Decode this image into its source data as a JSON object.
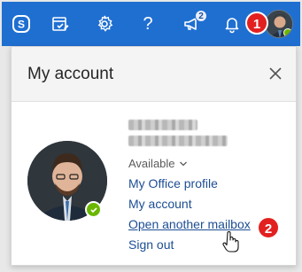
{
  "topbar": {
    "notifications_count": "2",
    "icons": [
      "skype-icon",
      "my-day-icon",
      "gear-icon",
      "help-icon",
      "megaphone-icon",
      "bell-icon"
    ],
    "help_glyph": "?"
  },
  "steps": {
    "step1": "1",
    "step2": "2"
  },
  "panel": {
    "title": "My account",
    "status": "Available",
    "links": [
      {
        "label": "My Office profile"
      },
      {
        "label": "My account"
      },
      {
        "label": "Open another mailbox"
      },
      {
        "label": "Sign out"
      }
    ]
  },
  "colors": {
    "header_blue": "#1f6fd1",
    "link_blue": "#1d4e94",
    "step_red": "#e32020",
    "presence_green": "#6bb700"
  }
}
